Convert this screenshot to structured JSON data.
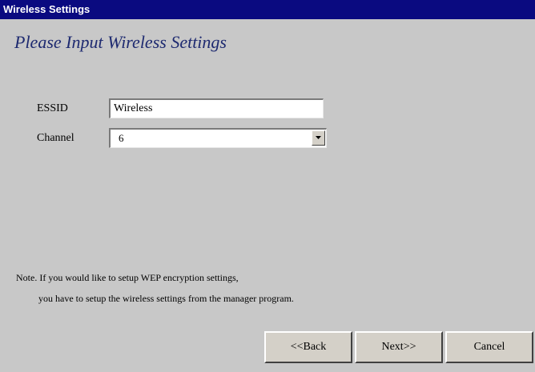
{
  "window": {
    "title": "Wireless Settings"
  },
  "main": {
    "heading": "Please Input Wireless Settings",
    "essid": {
      "label": "ESSID",
      "value": "Wireless"
    },
    "channel": {
      "label": "Channel",
      "selected": "6"
    },
    "note": {
      "line1": "Note. If you would like to setup WEP encryption settings,",
      "line2": "you have to setup  the wireless settings from the manager program."
    }
  },
  "buttons": {
    "back_label": "<<Back",
    "next_label": "Next>>",
    "cancel_label": "Cancel"
  },
  "colors": {
    "titlebar": "#0a0a80",
    "heading": "#1e2a70",
    "background": "#c8c8c8"
  },
  "icons": {
    "dropdown": "chevron-down-icon"
  }
}
